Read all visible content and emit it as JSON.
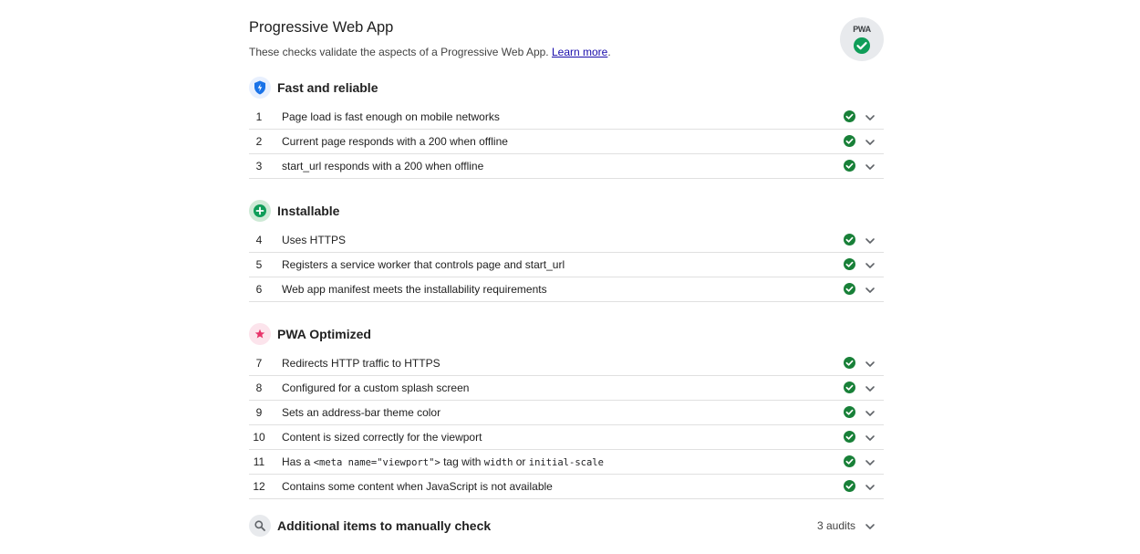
{
  "category": {
    "title": "Progressive Web App",
    "description": "These checks validate the aspects of a Progressive Web App.",
    "learn_more": "Learn more",
    "badge_text": "PWA",
    "badge_icon": "pwa-check-icon"
  },
  "colors": {
    "pass": "#188038",
    "fast_reliable": "#4285f4",
    "installable": "#0f9d58",
    "pwa_optimized": "#e8336a",
    "manual": "#e8eaed"
  },
  "groups": [
    {
      "title": "Fast and reliable",
      "icon": "lightning-shield-icon",
      "audits": [
        {
          "num": "1",
          "label": "Page load is fast enough on mobile networks",
          "status": "pass"
        },
        {
          "num": "2",
          "label": "Current page responds with a 200 when offline",
          "status": "pass"
        },
        {
          "num": "3",
          "label": "start_url responds with a 200 when offline",
          "status": "pass"
        }
      ]
    },
    {
      "title": "Installable",
      "icon": "plus-circle-icon",
      "audits": [
        {
          "num": "4",
          "label": "Uses HTTPS",
          "status": "pass"
        },
        {
          "num": "5",
          "label": "Registers a service worker that controls page and start_url",
          "status": "pass"
        },
        {
          "num": "6",
          "label": "Web app manifest meets the installability requirements",
          "status": "pass"
        }
      ]
    },
    {
      "title": "PWA Optimized",
      "icon": "star-icon",
      "audits": [
        {
          "num": "7",
          "label": "Redirects HTTP traffic to HTTPS",
          "status": "pass"
        },
        {
          "num": "8",
          "label": "Configured for a custom splash screen",
          "status": "pass"
        },
        {
          "num": "9",
          "label": "Sets an address-bar theme color",
          "status": "pass"
        },
        {
          "num": "10",
          "label": "Content is sized correctly for the viewport",
          "status": "pass"
        },
        {
          "num": "11",
          "label_parts": {
            "prefix": "Has a ",
            "code1": "<meta name=\"viewport\">",
            "middle1": " tag with ",
            "code2": "width",
            "middle2": " or ",
            "code3": "initial-scale"
          },
          "status": "pass"
        },
        {
          "num": "12",
          "label": "Contains some content when JavaScript is not available",
          "status": "pass"
        }
      ]
    }
  ],
  "manual": {
    "title": "Additional items to manually check",
    "icon": "search-icon",
    "count_label": "3 audits"
  }
}
